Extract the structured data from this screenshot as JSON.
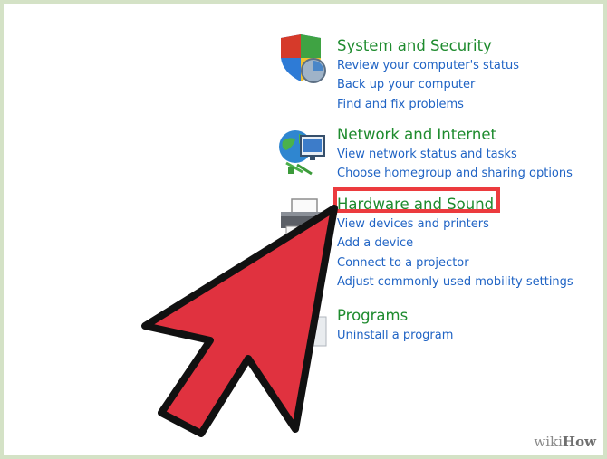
{
  "categories": [
    {
      "title": "System and Security",
      "icon": "shield-icon",
      "links": [
        "Review your computer's status",
        "Back up your computer",
        "Find and fix problems"
      ]
    },
    {
      "title": "Network and Internet",
      "icon": "globe-network-icon",
      "links": [
        "View network status and tasks",
        "Choose homegroup and sharing options"
      ]
    },
    {
      "title": "Hardware and Sound",
      "icon": "printer-icon",
      "links": [
        "View devices and printers",
        "Add a device",
        "Connect to a projector",
        "Adjust commonly used mobility settings"
      ]
    },
    {
      "title": "Programs",
      "icon": "programs-icon",
      "links": [
        "Uninstall a program"
      ]
    }
  ],
  "watermark": {
    "wiki": "wiki",
    "how": "How"
  },
  "colors": {
    "category_title": "#1e8b2e",
    "link": "#1f63c4",
    "highlight": "#ec3b3e",
    "arrow": "#e0323f",
    "frame": "#d4e2c6"
  }
}
